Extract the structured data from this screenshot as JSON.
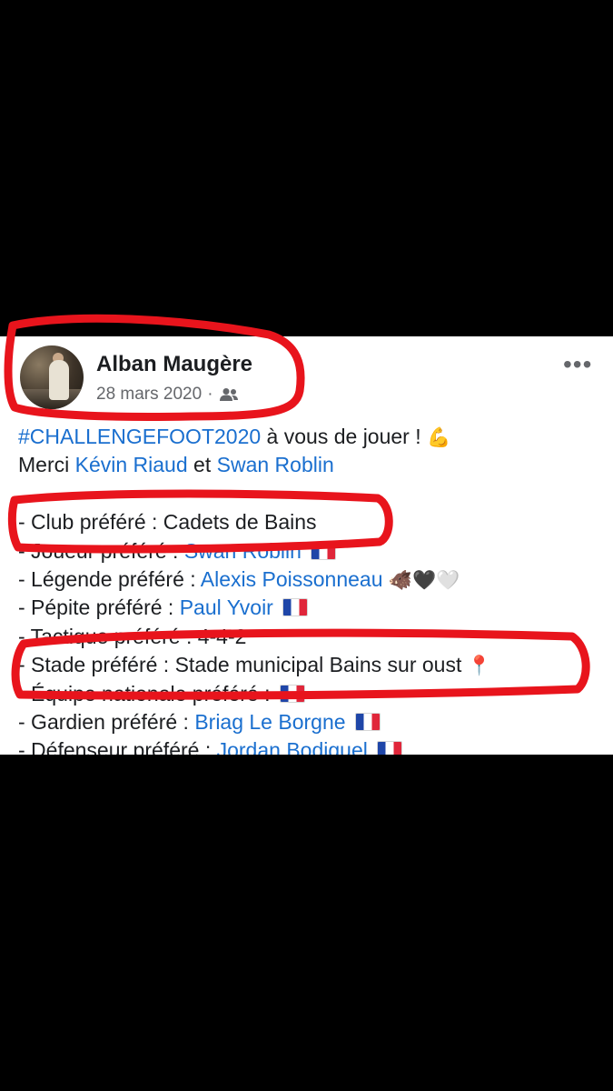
{
  "post": {
    "author": "Alban Maugère",
    "date": "28 mars 2020",
    "separator": "·",
    "audience_icon": "friends-icon",
    "more_icon": "more-options-icon",
    "more_label": "•••",
    "line1": {
      "hashtag": "#CHALLENGEFOOT2020",
      "rest": " à vous de jouer !",
      "emoji": "💪"
    },
    "line2": {
      "prefix": "Merci ",
      "tag1": "Kévin Riaud",
      "mid": " et ",
      "tag2": "Swan Roblin"
    },
    "list": [
      {
        "text": "- Club préféré : Cadets de Bains"
      },
      {
        "text": "- Joueur préféré : ",
        "tag": "Swan Roblin",
        "flag": "FR"
      },
      {
        "text": "- Légende préféré : ",
        "tag": "Alexis Poissonneau",
        "emoji": "🐗🖤🤍"
      },
      {
        "text": "- Pépite préféré : ",
        "tag": "Paul Yvoir",
        "flag": "FR"
      },
      {
        "text": "- Tactique préféré : 4-4-2"
      },
      {
        "text": "- Stade préféré : Stade municipal Bains sur oust",
        "emoji": "📍"
      },
      {
        "text": "- Équipe nationale préféré : ",
        "flag": "FR"
      },
      {
        "text": "- Gardien préféré : ",
        "tag": "Briag Le Borgne",
        "flag": "FR"
      },
      {
        "text": "- Défenseur préféré : ",
        "tag": "Jordan Bodiguel",
        "flag": "FR"
      }
    ]
  },
  "colors": {
    "link": "#1a6fcf",
    "annotation": "#e8141c",
    "background": "#000000"
  }
}
